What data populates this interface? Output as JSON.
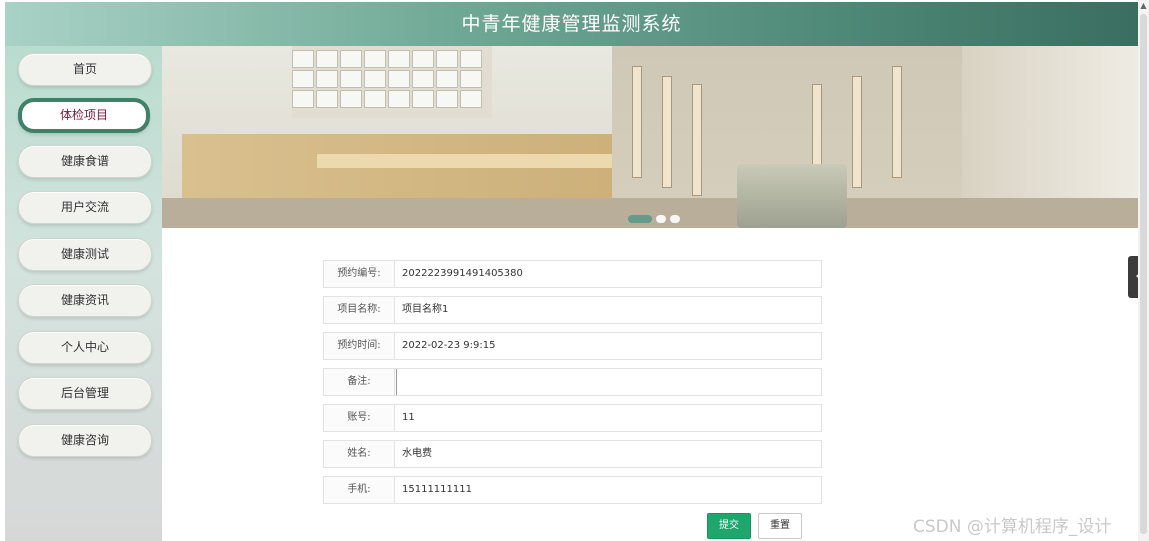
{
  "header": {
    "title": "中青年健康管理监测系统"
  },
  "sidebar": {
    "items": [
      {
        "label": "首页",
        "active": false
      },
      {
        "label": "体检项目",
        "active": true
      },
      {
        "label": "健康食谱",
        "active": false
      },
      {
        "label": "用户交流",
        "active": false
      },
      {
        "label": "健康测试",
        "active": false
      },
      {
        "label": "健康资讯",
        "active": false
      },
      {
        "label": "个人中心",
        "active": false
      },
      {
        "label": "后台管理",
        "active": false
      },
      {
        "label": "健康咨询",
        "active": false
      }
    ]
  },
  "banner": {
    "dots": 3,
    "active_dot": 0
  },
  "form": {
    "fields": [
      {
        "label": "预约编号:",
        "value": "2022223991491405380"
      },
      {
        "label": "项目名称:",
        "value": "项目名称1"
      },
      {
        "label": "预约时间:",
        "value": "2022-02-23 9:9:15"
      },
      {
        "label": "备注:",
        "value": ""
      },
      {
        "label": "账号:",
        "value": "11"
      },
      {
        "label": "姓名:",
        "value": "水电费"
      },
      {
        "label": "手机:",
        "value": "15111111111"
      }
    ],
    "submit_label": "提交",
    "reset_label": "重置"
  },
  "watermark": "CSDN @计算机程序_设计",
  "colors": {
    "accent": "#3f8068",
    "submit": "#1ea66d",
    "active_text": "#7a1a3a"
  }
}
